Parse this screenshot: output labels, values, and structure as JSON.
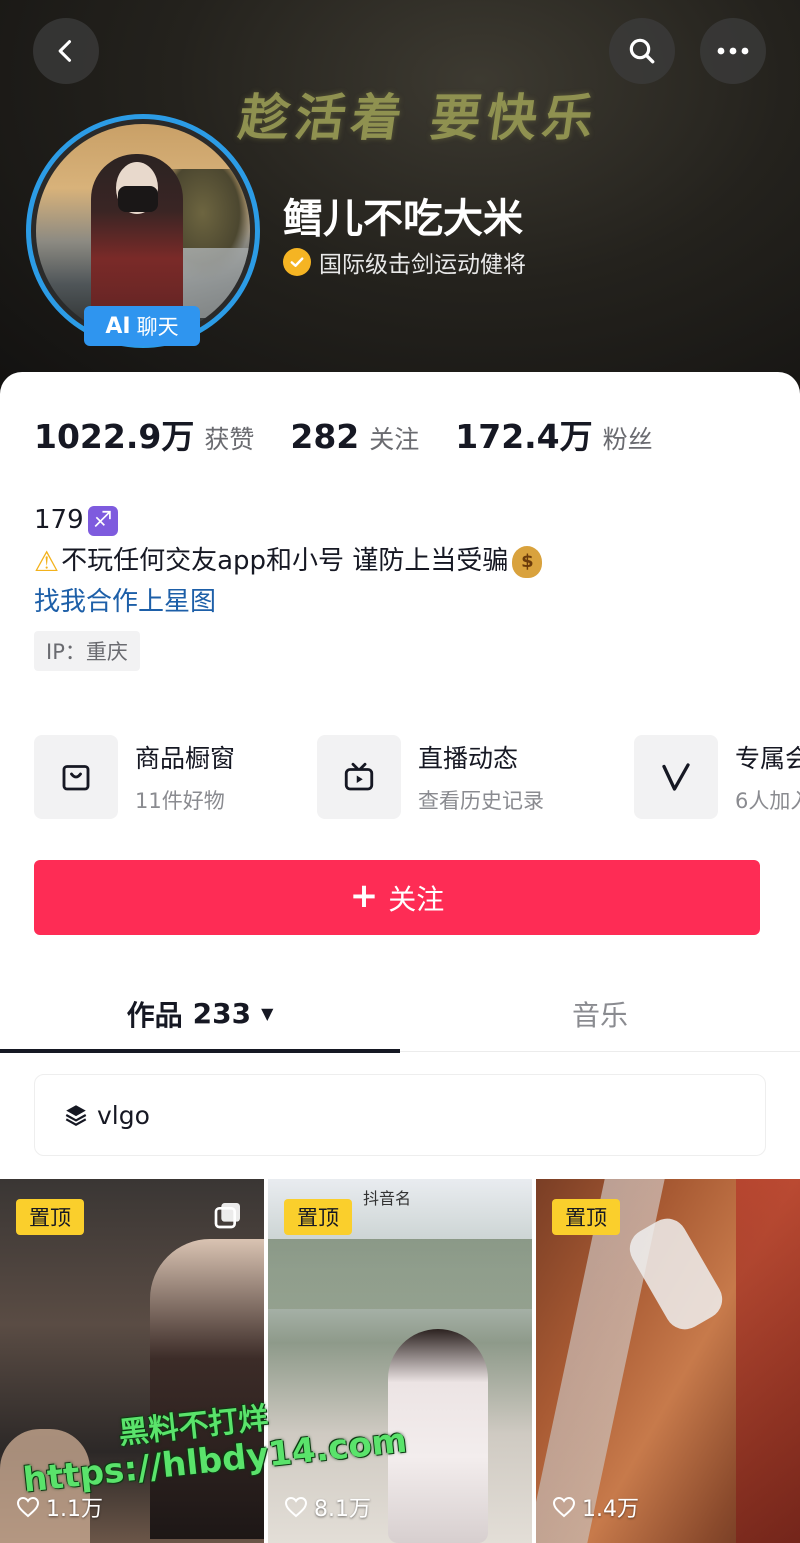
{
  "header": {
    "banner_text": "趁活着 要快乐",
    "profile_name": "鳕儿不吃大米",
    "verified_label": "国际级击剑运动健将",
    "ai_badge": {
      "prefix": "AI",
      "label": "聊天"
    }
  },
  "stats": [
    {
      "value": "1022.9万",
      "label": "获赞"
    },
    {
      "value": "282",
      "label": "关注"
    },
    {
      "value": "172.4万",
      "label": "粉丝"
    }
  ],
  "bio": {
    "line1": "179",
    "line2": "不玩任何交友app和小号 谨防上当受骗",
    "link": "找我合作上星图",
    "ip_tag": "IP：重庆"
  },
  "services": [
    {
      "title": "商品橱窗",
      "subtitle": "11件好物",
      "icon": "shopping-bag-icon"
    },
    {
      "title": "直播动态",
      "subtitle": "查看历史记录",
      "icon": "live-tv-icon"
    },
    {
      "title": "专属会",
      "subtitle": "6人加入",
      "icon": "v-member-icon"
    }
  ],
  "follow_button": "关注",
  "tabs": {
    "works_label": "作品",
    "works_count": "233",
    "music_label": "音乐"
  },
  "collection": {
    "label": "vlgo"
  },
  "videos": [
    {
      "pinned": "置顶",
      "likes": "1.1万"
    },
    {
      "pinned": "置顶",
      "likes": "8.1万",
      "overlay_text": "抖音名"
    },
    {
      "pinned": "置顶",
      "likes": "1.4万"
    }
  ],
  "watermark": {
    "line1": "黑料不打烊",
    "line2": "https://hlbdy14.com"
  },
  "colors": {
    "accent": "#fe2c55",
    "link": "#1d5fa8",
    "pinned": "#facf2c",
    "avatar_ring": "#2c9ce6"
  }
}
